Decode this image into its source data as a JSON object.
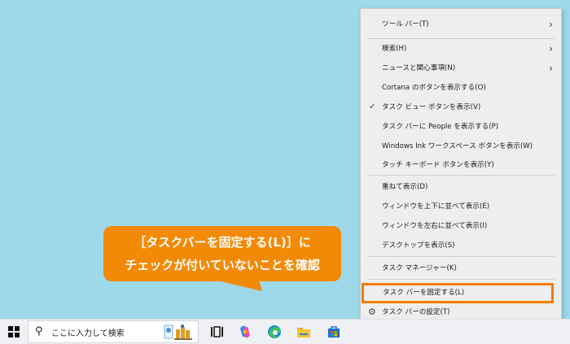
{
  "context_menu": {
    "items": [
      {
        "label": "ツール バー(T)",
        "submenu": true
      },
      {
        "label": "検索(H)",
        "submenu": true
      },
      {
        "label": "ニュースと関心事項(N)",
        "submenu": true
      },
      {
        "label": "Cortana のボタンを表示する(O)"
      },
      {
        "label": "タスク ビュー ボタンを表示(V)",
        "checked": true
      },
      {
        "label": "タスク バーに People を表示する(P)"
      },
      {
        "label": "Windows Ink ワークスペース ボタンを表示(W)"
      },
      {
        "label": "タッチ キーボード ボタンを表示(Y)"
      },
      {
        "label": "重ねて表示(D)"
      },
      {
        "label": "ウィンドウを上下に並べて表示(E)"
      },
      {
        "label": "ウィンドウを左右に並べて表示(I)"
      },
      {
        "label": "デスクトップを表示(S)"
      },
      {
        "label": "タスク マネージャー(K)"
      },
      {
        "label": "タスク バーを固定する(L)",
        "highlighted": true
      },
      {
        "label": "タスク バーの設定(T)",
        "icon": "gear-icon"
      }
    ]
  },
  "callout": {
    "line1": "［タスクバーを固定する(L)］に",
    "line2": "チェックが付いていないことを確認",
    "color": "#f38a07"
  },
  "taskbar": {
    "search_placeholder": "ここに入力して検索",
    "icons": [
      "windows-start-icon",
      "search-icon",
      "task-view-icon",
      "copilot-icon",
      "edge-icon",
      "file-explorer-icon",
      "store-icon"
    ]
  },
  "colors": {
    "desktop": "#9ed9ea",
    "highlight_border": "#f07c00",
    "menu_background": "#eeeeee"
  }
}
